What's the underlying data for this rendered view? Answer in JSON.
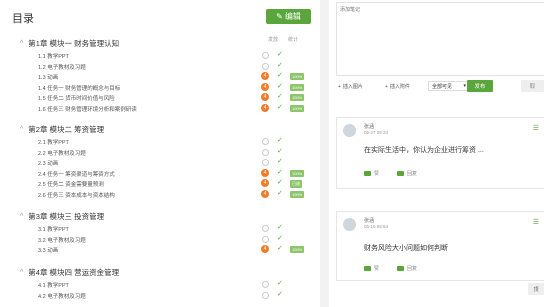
{
  "toc": {
    "title": "目录",
    "edit_label": "编辑",
    "col_release": "发放",
    "col_stats": "统计",
    "chapters": [
      {
        "title": "第1章 模块一 财务管理认知",
        "lessons": [
          {
            "num": "1.1",
            "label": "教学PPT",
            "state": "circle",
            "pct": ""
          },
          {
            "num": "1.2",
            "label": "电子教材及习题",
            "state": "circle",
            "pct": ""
          },
          {
            "num": "1.3",
            "label": "动画",
            "state": "badge",
            "badge": "4",
            "pct": "100%"
          },
          {
            "num": "1.4",
            "label": "任务一 财务管理的概念与目标",
            "state": "badge",
            "badge": "4",
            "pct": "100%"
          },
          {
            "num": "1.5",
            "label": "任务二 货币时间价值与风险",
            "state": "badge",
            "badge": "4",
            "pct": "100%"
          },
          {
            "num": "1.6",
            "label": "任务三 财务管理环境分析和案例研读",
            "state": "badge",
            "badge": "4",
            "pct": "100%"
          }
        ]
      },
      {
        "title": "第2章 模块二 筹资管理",
        "lessons": [
          {
            "num": "2.1",
            "label": "教学PPT",
            "state": "circle",
            "pct": ""
          },
          {
            "num": "2.2",
            "label": "电子教材及习题",
            "state": "circle",
            "pct": ""
          },
          {
            "num": "2.3",
            "label": "动画",
            "state": "circle",
            "pct": ""
          },
          {
            "num": "2.4",
            "label": "任务一 筹资渠道与筹资方式",
            "state": "badge",
            "badge": "4",
            "pct": "100%"
          },
          {
            "num": "2.5",
            "label": "任务二 资金需要量预测",
            "state": "badge",
            "badge": "4",
            "pct": "已放"
          },
          {
            "num": "2.6",
            "label": "任务三 资本成本与资本结构",
            "state": "badge",
            "badge": "4",
            "pct": "100%"
          }
        ]
      },
      {
        "title": "第3章 模块三 投资管理",
        "lessons": [
          {
            "num": "3.1",
            "label": "教学PPT",
            "state": "circle",
            "pct": ""
          },
          {
            "num": "3.2",
            "label": "电子教材及习题",
            "state": "circle",
            "pct": ""
          },
          {
            "num": "3.3",
            "label": "动画",
            "state": "badge",
            "badge": "4",
            "pct": "100%"
          }
        ]
      },
      {
        "title": "第4章 模块四 营运资金管理",
        "lessons": [
          {
            "num": "4.1",
            "label": "教学PPT",
            "state": "circle",
            "pct": ""
          },
          {
            "num": "4.2",
            "label": "电子教材及习题",
            "state": "circle",
            "pct": ""
          }
        ]
      }
    ]
  },
  "note": {
    "placeholder": "添加笔记",
    "insert_image": "插入图片",
    "insert_attachment": "插入附件",
    "visibility": "全部可见",
    "publish": "发布",
    "cancel": "取"
  },
  "posts": [
    {
      "user": "张涵",
      "time": "05-27 09:24",
      "content": "在实际生活中，你认为企业进行筹资 ...",
      "like": "赞",
      "reply": "回复"
    },
    {
      "user": "张涵",
      "time": "05-16 08:54",
      "content": "财务风险大小问题如何判断",
      "like": "赞",
      "reply": "回复"
    }
  ],
  "side_button": "顶"
}
